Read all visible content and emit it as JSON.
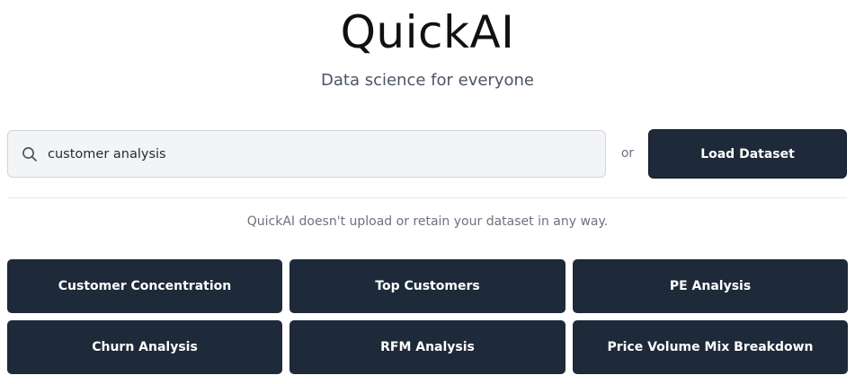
{
  "header": {
    "title": "QuickAI",
    "subtitle": "Data science for everyone"
  },
  "search": {
    "value": "customer analysis",
    "icon": "search-icon"
  },
  "separator": {
    "or_label": "or"
  },
  "load_dataset": {
    "label": "Load Dataset"
  },
  "privacy": {
    "note": "QuickAI doesn't upload or retain your dataset in any way."
  },
  "analyses": [
    {
      "label": "Customer Concentration"
    },
    {
      "label": "Top Customers"
    },
    {
      "label": "PE Analysis"
    },
    {
      "label": "Churn Analysis"
    },
    {
      "label": "RFM Analysis"
    },
    {
      "label": "Price Volume Mix Breakdown"
    }
  ],
  "colors": {
    "button_bg": "#1e2939",
    "button_text": "#ffffff",
    "search_bg": "#f3f4f6",
    "muted_text": "#6b7280"
  }
}
